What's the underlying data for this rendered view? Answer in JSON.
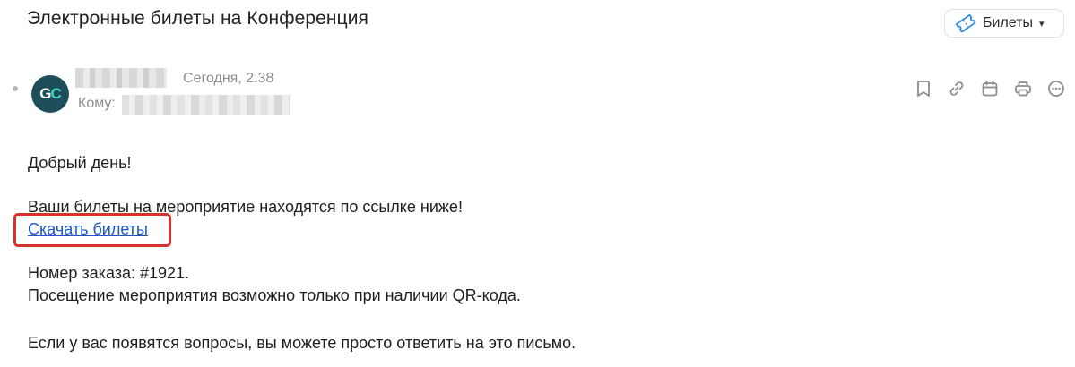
{
  "email": {
    "subject": "Электронные билеты на Конференция",
    "tag": {
      "label": "Билеты",
      "icon": "ticket-icon",
      "caret": "▾",
      "color": "#2f8fe6"
    },
    "sender": {
      "avatar_initials_1": "G",
      "avatar_initials_2": "C",
      "avatar_bg": "#1d4e59",
      "date": "Сегодня, 2:38",
      "to_label": "Кому:"
    },
    "actions": [
      {
        "name": "bookmark-icon"
      },
      {
        "name": "link-icon"
      },
      {
        "name": "calendar-icon"
      },
      {
        "name": "print-icon"
      },
      {
        "name": "more-icon"
      }
    ],
    "body": {
      "greeting": "Добрый день!",
      "tickets_line": "Ваши билеты на мероприятие находятся по ссылке ниже!",
      "download_link": "Скачать билеты",
      "order_line": "Номер заказа: #1921.",
      "qr_line": "Посещение мероприятия возможно только при наличии QR-кода.",
      "questions_line": "Если у вас появятся вопросы, вы можете просто ответить на это письмо."
    },
    "highlight_color": "#d8322e"
  }
}
